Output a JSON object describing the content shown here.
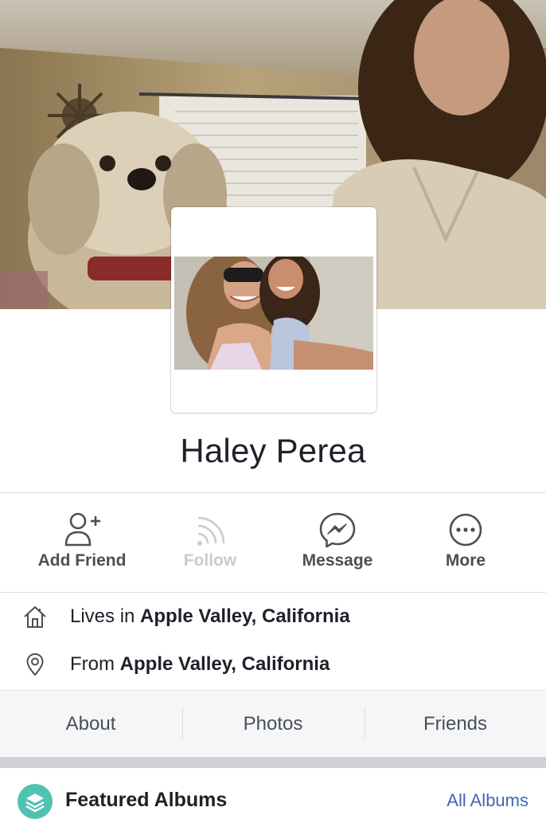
{
  "profile": {
    "name": "Haley Perea"
  },
  "actions": [
    {
      "label": "Add Friend",
      "icon": "add-friend-icon",
      "enabled": true
    },
    {
      "label": "Follow",
      "icon": "follow-icon",
      "enabled": false
    },
    {
      "label": "Message",
      "icon": "messenger-icon",
      "enabled": true
    },
    {
      "label": "More",
      "icon": "more-icon",
      "enabled": true
    }
  ],
  "info": {
    "lives": {
      "prefix": "Lives in ",
      "place": "Apple Valley, California",
      "icon": "home-icon"
    },
    "from": {
      "prefix": "From ",
      "place": "Apple Valley, California",
      "icon": "location-pin-icon"
    }
  },
  "tabs": [
    "About",
    "Photos",
    "Friends"
  ],
  "albums": {
    "title": "Featured Albums",
    "link": "All Albums",
    "icon": "featured-albums-icon"
  },
  "colors": {
    "link": "#4267b2",
    "album_icon": "#4fc3b0",
    "tab_bar": "#f5f6f7"
  }
}
